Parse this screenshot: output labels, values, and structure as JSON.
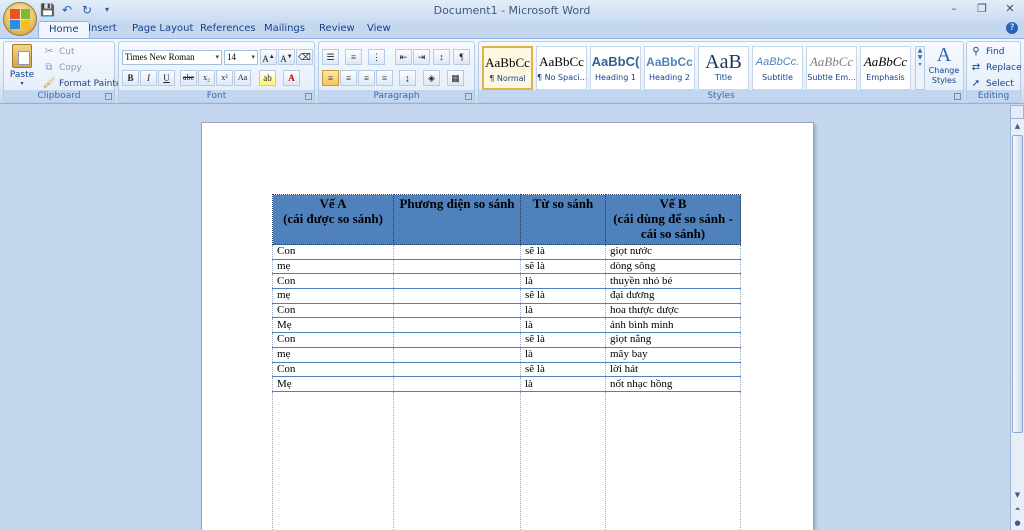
{
  "window": {
    "title": "Document1 - Microsoft Word",
    "controls": [
      "–",
      "❐",
      "✕"
    ]
  },
  "tabs": [
    "Home",
    "Insert",
    "Page Layout",
    "References",
    "Mailings",
    "Review",
    "View"
  ],
  "clipboard": {
    "paste": "Paste",
    "cut": "Cut",
    "copy": "Copy",
    "format_painter": "Format Painter",
    "label": "Clipboard"
  },
  "font": {
    "name": "Times New Roman",
    "size": "14",
    "label": "Font"
  },
  "paragraph": {
    "label": "Paragraph"
  },
  "styles": {
    "label": "Styles",
    "items": [
      {
        "sample": "AaBbCc",
        "name": "¶ Normal"
      },
      {
        "sample": "AaBbCc",
        "name": "¶ No Spaci..."
      },
      {
        "sample": "AaBbC(",
        "name": "Heading 1"
      },
      {
        "sample": "AaBbCc",
        "name": "Heading 2"
      },
      {
        "sample": "AaB",
        "name": "Title"
      },
      {
        "sample": "AaBbCc.",
        "name": "Subtitle"
      },
      {
        "sample": "AaBbCc",
        "name": "Subtle Em..."
      },
      {
        "sample": "AaBbCc",
        "name": "Emphasis"
      }
    ],
    "change": "Change Styles"
  },
  "editing": {
    "find": "Find",
    "replace": "Replace",
    "select": "Select",
    "label": "Editing"
  },
  "table": {
    "headers": [
      "Vế A\n(cái được so sánh)",
      "Phương diện so sánh",
      "Từ so sánh",
      "Vế B\n(cái dùng để so sánh - cái so sánh)"
    ],
    "rows": [
      [
        "Con",
        "",
        "sẽ là",
        "giọt nước"
      ],
      [
        "mẹ",
        "",
        "sẽ là",
        "dòng sông"
      ],
      [
        "Con",
        "",
        "là",
        "thuyền nhỏ bé"
      ],
      [
        "mẹ",
        "",
        "sẽ là",
        "đại dương"
      ],
      [
        "Con",
        "",
        "là",
        "hoa thược dược"
      ],
      [
        "Mẹ",
        "",
        "là",
        "ánh bình minh"
      ],
      [
        "Con",
        "",
        "sẽ là",
        "giọt nắng"
      ],
      [
        "mẹ",
        "",
        "là",
        "mây bay"
      ],
      [
        "Con",
        "",
        "sẽ là",
        "lời hát"
      ],
      [
        "Mẹ",
        "",
        "là",
        "nốt nhạc hồng"
      ]
    ]
  }
}
